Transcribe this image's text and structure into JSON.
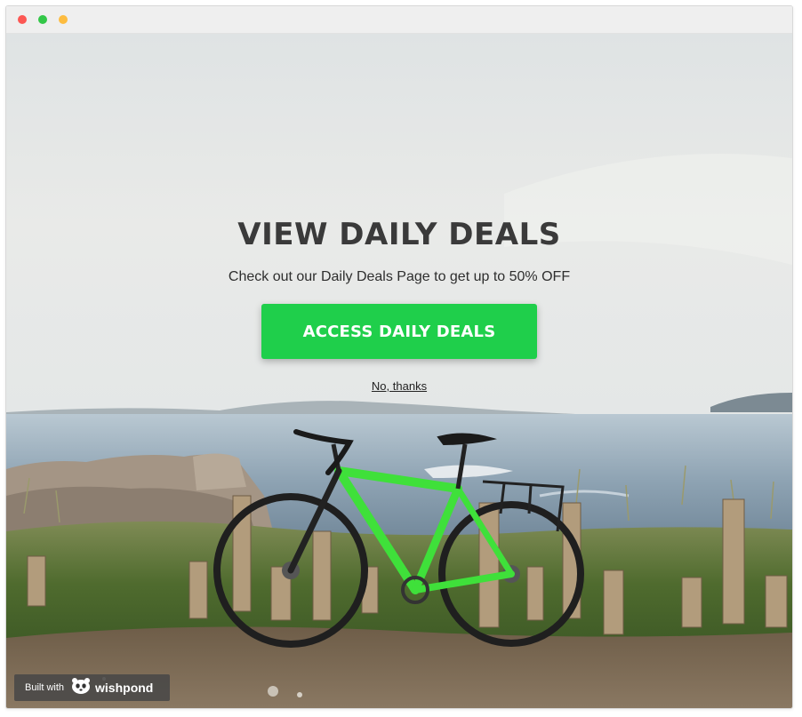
{
  "window": {
    "traffic_lights": [
      {
        "name": "close",
        "color": "#fc5753"
      },
      {
        "name": "minimize",
        "color": "#fdbc40"
      },
      {
        "name": "zoom",
        "color": "#33c748"
      }
    ]
  },
  "popup": {
    "headline": "VIEW DAILY DEALS",
    "subheadline": "Check out our Daily Deals Page to get up to 50% OFF",
    "cta_label": "ACCESS DAILY DEALS",
    "decline_label": "No, thanks",
    "cta_color": "#1fcf4b"
  },
  "badge": {
    "built_with": "Built with",
    "brand": "wishpond",
    "icon": "panda-icon"
  },
  "background": {
    "description_icon": "bicycle-icon",
    "bike_color": "#3fe03a"
  }
}
